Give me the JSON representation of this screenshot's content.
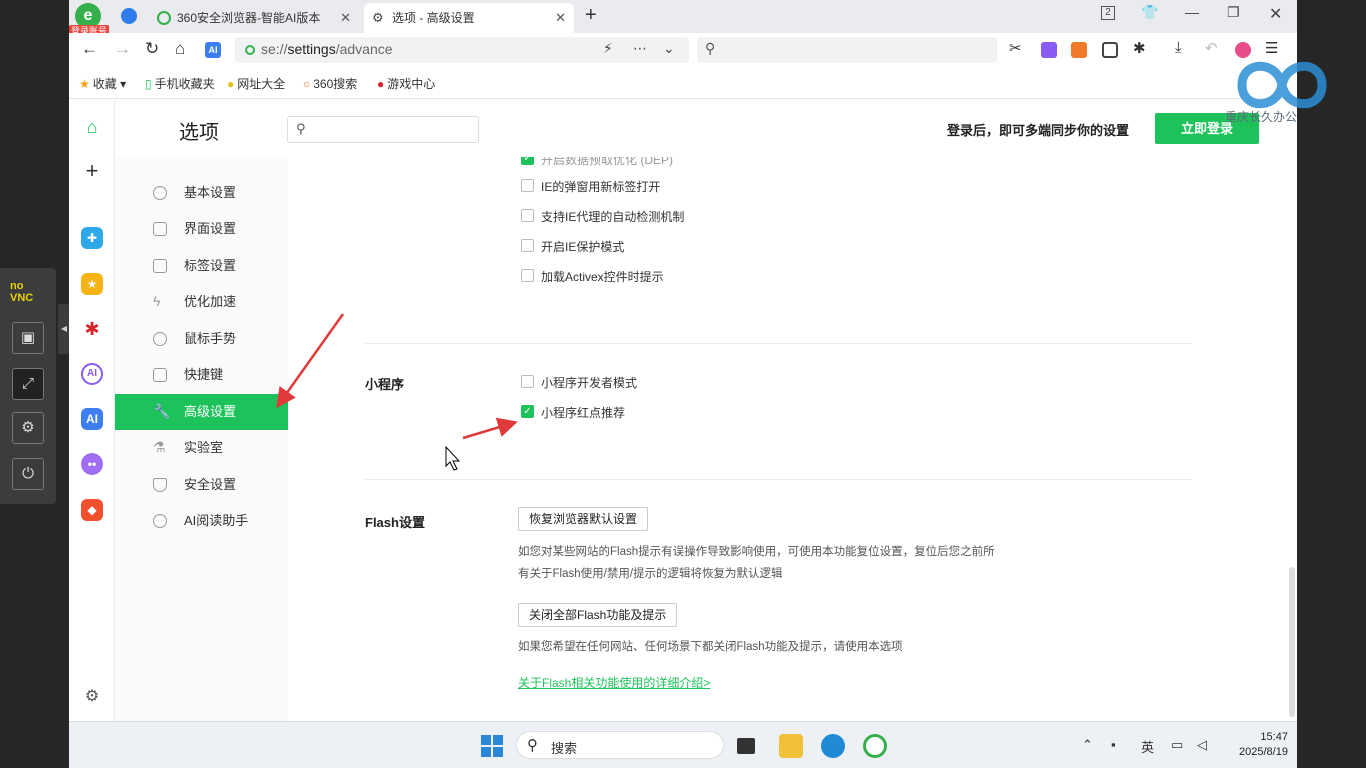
{
  "tabs": {
    "badge": "登录账号",
    "tab1": "360安全浏览器-智能AI版本",
    "tab2": "选项 - 高级设置",
    "tab_count": "2"
  },
  "address": {
    "url_prefix": "se://",
    "url_host": "settings",
    "url_path": "/advance"
  },
  "bookmarks": [
    "收藏",
    "手机收藏夹",
    "网址大全",
    "360搜索",
    "游戏中心"
  ],
  "rail_labels": {
    "ai1": "AI",
    "ai2": "AI"
  },
  "header": {
    "title": "选项",
    "sync_text": "登录后，即可多端同步你的设置",
    "login_button": "立即登录"
  },
  "nav": [
    "基本设置",
    "界面设置",
    "标签设置",
    "优化加速",
    "鼠标手势",
    "快捷键",
    "高级设置",
    "实验室",
    "安全设置",
    "AI阅读助手"
  ],
  "content": {
    "top_partial": "开启数据预取优化 (DEP)",
    "ie_options": [
      {
        "label": "IE的弹窗用新标签打开",
        "checked": false
      },
      {
        "label": "支持IE代理的自动检测机制",
        "checked": false
      },
      {
        "label": "开启IE保护模式",
        "checked": false
      },
      {
        "label": "加载Activex控件时提示",
        "checked": false
      }
    ],
    "mini_program": {
      "title": "小程序",
      "options": [
        {
          "label": "小程序开发者模式",
          "checked": false
        },
        {
          "label": "小程序红点推荐",
          "checked": true
        }
      ]
    },
    "flash": {
      "title": "Flash设置",
      "restore_button": "恢复浏览器默认设置",
      "restore_desc_1": "如您对某些网站的Flash提示有误操作导致影响使用，可使用本功能复位设置，复位后您之前所",
      "restore_desc_2": "有关于Flash使用/禁用/提示的逻辑将恢复为默认逻辑",
      "disable_button": "关闭全部Flash功能及提示",
      "disable_desc": "如果您希望在任何网站、任何场景下都关闭Flash功能及提示，请使用本选项",
      "link": "关于Flash相关功能使用的详细介绍>"
    }
  },
  "taskbar": {
    "search": "搜索",
    "ime": "英",
    "time": "15:47",
    "date": "2025/8/19"
  },
  "vnc": {
    "logo_top": "no",
    "logo_bottom": "VNC"
  },
  "watermark": "重庆长久办公"
}
